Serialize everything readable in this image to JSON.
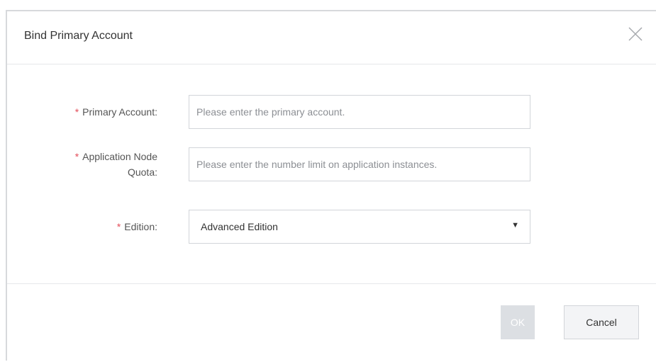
{
  "dialog": {
    "title": "Bind Primary Account",
    "close_icon": "close-icon"
  },
  "form": {
    "primary_account": {
      "required_mark": "*",
      "label": "Primary Account:",
      "placeholder": "Please enter the primary account.",
      "value": ""
    },
    "application_node_quota": {
      "required_mark": "*",
      "label_line1": "Application Node",
      "label_line2": "Quota:",
      "placeholder": "Please enter the number limit on application instances.",
      "value": ""
    },
    "edition": {
      "required_mark": "*",
      "label": "Edition:",
      "selected": "Advanced Edition",
      "caret_icon": "caret-down-icon"
    }
  },
  "footer": {
    "ok_label": "OK",
    "cancel_label": "Cancel"
  },
  "colors": {
    "required": "#e34d59",
    "ok_disabled_bg": "#dcdfe3",
    "border": "#d2d5d9"
  }
}
